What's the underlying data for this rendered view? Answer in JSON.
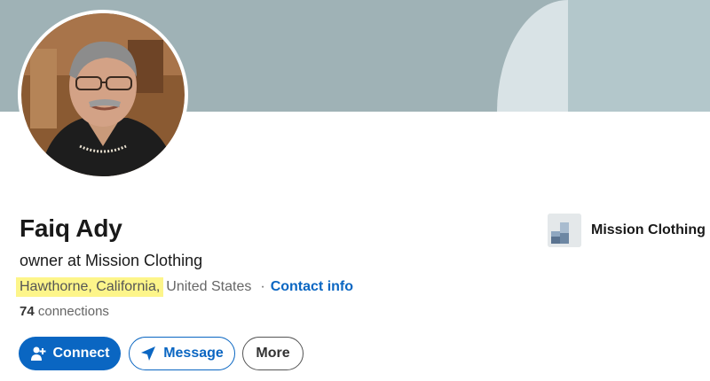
{
  "profile": {
    "name": "Faiq Ady",
    "headline": "owner at Mission Clothing",
    "location_city": "Hawthorne, California,",
    "location_country": "United States",
    "separator": "·",
    "contact_info_label": "Contact info",
    "connections_count": "74",
    "connections_label": "connections"
  },
  "actions": {
    "connect_label": "Connect",
    "message_label": "Message",
    "more_label": "More"
  },
  "company": {
    "name": "Mission Clothing",
    "logo_icon": "company-logo-icon"
  },
  "colors": {
    "accent": "#0a66c2",
    "banner": "#9fb2b6",
    "highlight": "#fdf58a"
  }
}
